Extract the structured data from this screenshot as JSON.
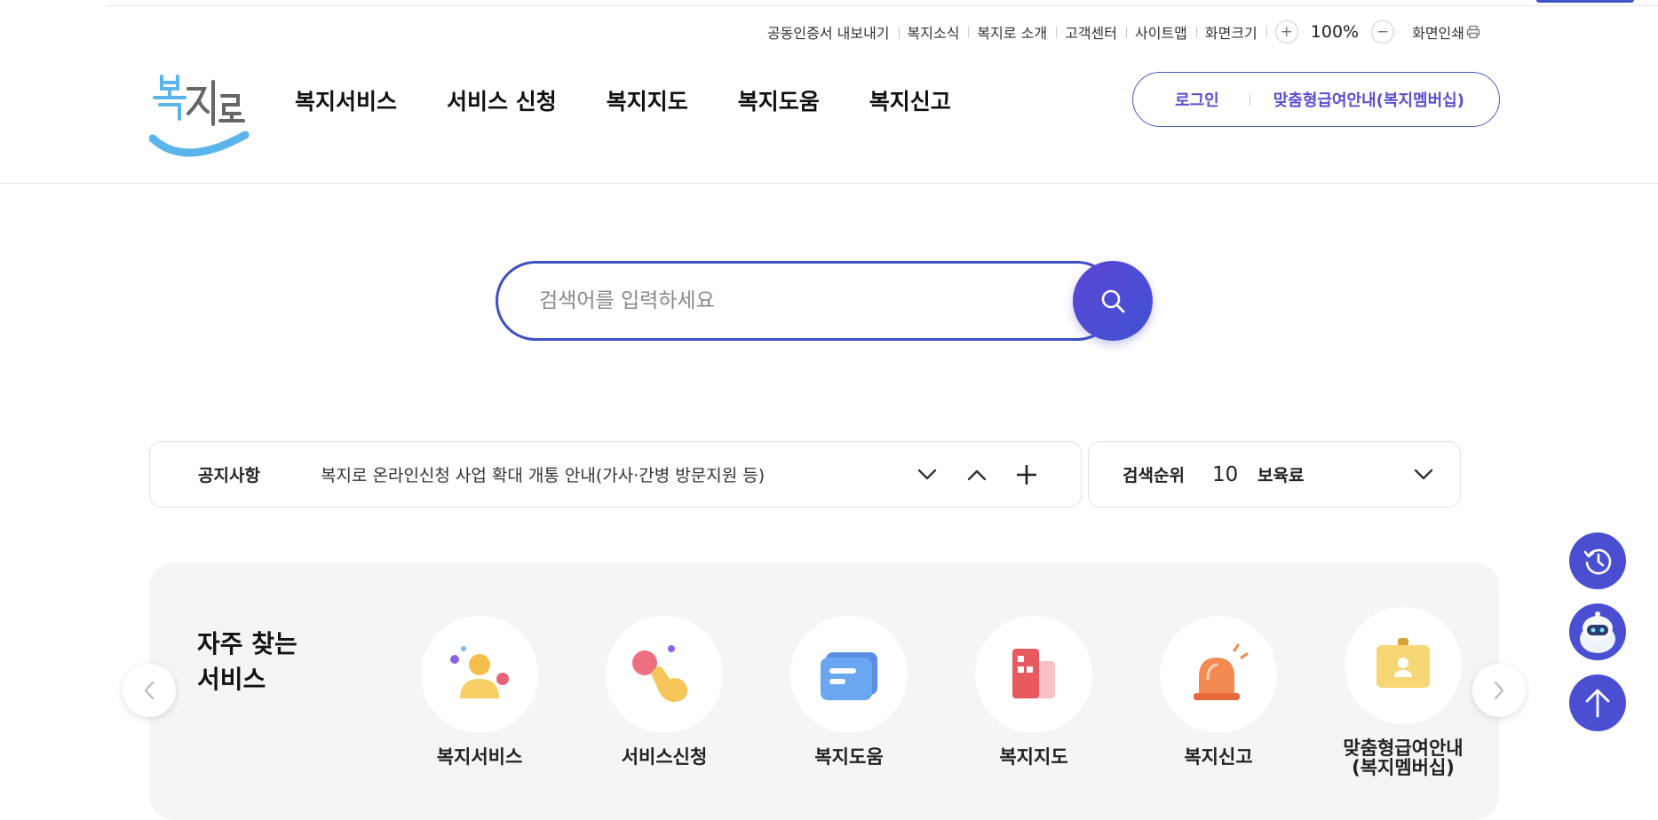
{
  "utility": {
    "items": [
      "공동인증서 내보내기",
      "복지소식",
      "복지로 소개",
      "고객센터",
      "사이트맵",
      "화면크기"
    ],
    "zoom_in": "+",
    "zoom_level": "100%",
    "zoom_out": "−",
    "print_label": "화면인쇄"
  },
  "header": {
    "logo_text": "복지로",
    "gnb": [
      "복지서비스",
      "서비스 신청",
      "복지지도",
      "복지도움",
      "복지신고"
    ],
    "login": "로그인",
    "member": "맞춤형급여안내(복지멤버십)"
  },
  "search": {
    "placeholder": "검색어를 입력하세요"
  },
  "notice": {
    "label": "공지사항",
    "text": "복지로 온라인신청 사업 확대 개통 안내(가사·간병 방문지원 등)"
  },
  "ranking": {
    "label": "검색순위",
    "rank": "10",
    "keyword": "보육료"
  },
  "frequent": {
    "title_line1": "자주 찾는",
    "title_line2": "서비스",
    "services": [
      {
        "label": "복지서비스",
        "icon": "person-icon"
      },
      {
        "label": "서비스신청",
        "icon": "hand-tap-icon"
      },
      {
        "label": "복지도움",
        "icon": "message-icon"
      },
      {
        "label": "복지지도",
        "icon": "map-icon"
      },
      {
        "label": "복지신고",
        "icon": "siren-icon"
      },
      {
        "label": "맞춤형급여안내",
        "label2": "(복지멤버십)",
        "icon": "id-card-icon"
      }
    ]
  },
  "colors": {
    "primary": "#4a4fd2",
    "primary_text": "#5a4fd0",
    "logo_blue": "#5bb5ea"
  }
}
